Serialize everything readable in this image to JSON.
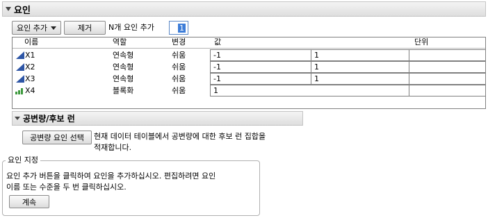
{
  "factors_section": {
    "title": "요인"
  },
  "toolbar": {
    "add_factor_label": "요인 추가",
    "remove_label": "제거",
    "add_n_label": "N개 요인 추가",
    "n_value": "1"
  },
  "table": {
    "headers": {
      "name": "이름",
      "role": "역할",
      "change": "변경",
      "values": "값",
      "units": "단위"
    },
    "rows": [
      {
        "name": "X1",
        "role": "연속형",
        "change": "쉬움",
        "low": "-1",
        "high": "1",
        "icon": "continuous-icon",
        "units": ""
      },
      {
        "name": "X2",
        "role": "연속형",
        "change": "쉬움",
        "low": "-1",
        "high": "1",
        "icon": "continuous-icon",
        "units": ""
      },
      {
        "name": "X3",
        "role": "연속형",
        "change": "쉬움",
        "low": "-1",
        "high": "1",
        "icon": "continuous-icon",
        "units": ""
      },
      {
        "name": "X4",
        "role": "블록화",
        "change": "쉬움",
        "low": "1",
        "icon": "blocking-icon",
        "units": ""
      }
    ]
  },
  "covariate_section": {
    "title": "공변량/후보 런",
    "button_label": "공변량 요인 선택",
    "description_line1": "현재 데이터 테이블에서 공변량에 대한 후보 런 집합을",
    "description_line2": "적재합니다."
  },
  "specify_factors": {
    "legend": "요인 지정",
    "text_line1": "요인 추가 버튼을 클릭하여 요인을 추가하십시오. 편집하려면 요인",
    "text_line2": "이름 또는 수준을 두 번 클릭하십시오.",
    "continue_label": "계속"
  },
  "colors": {
    "continuous_icon": "#2e56a6",
    "blocking_icon": "#3f9a3f",
    "accent": "#3d7dd8"
  }
}
